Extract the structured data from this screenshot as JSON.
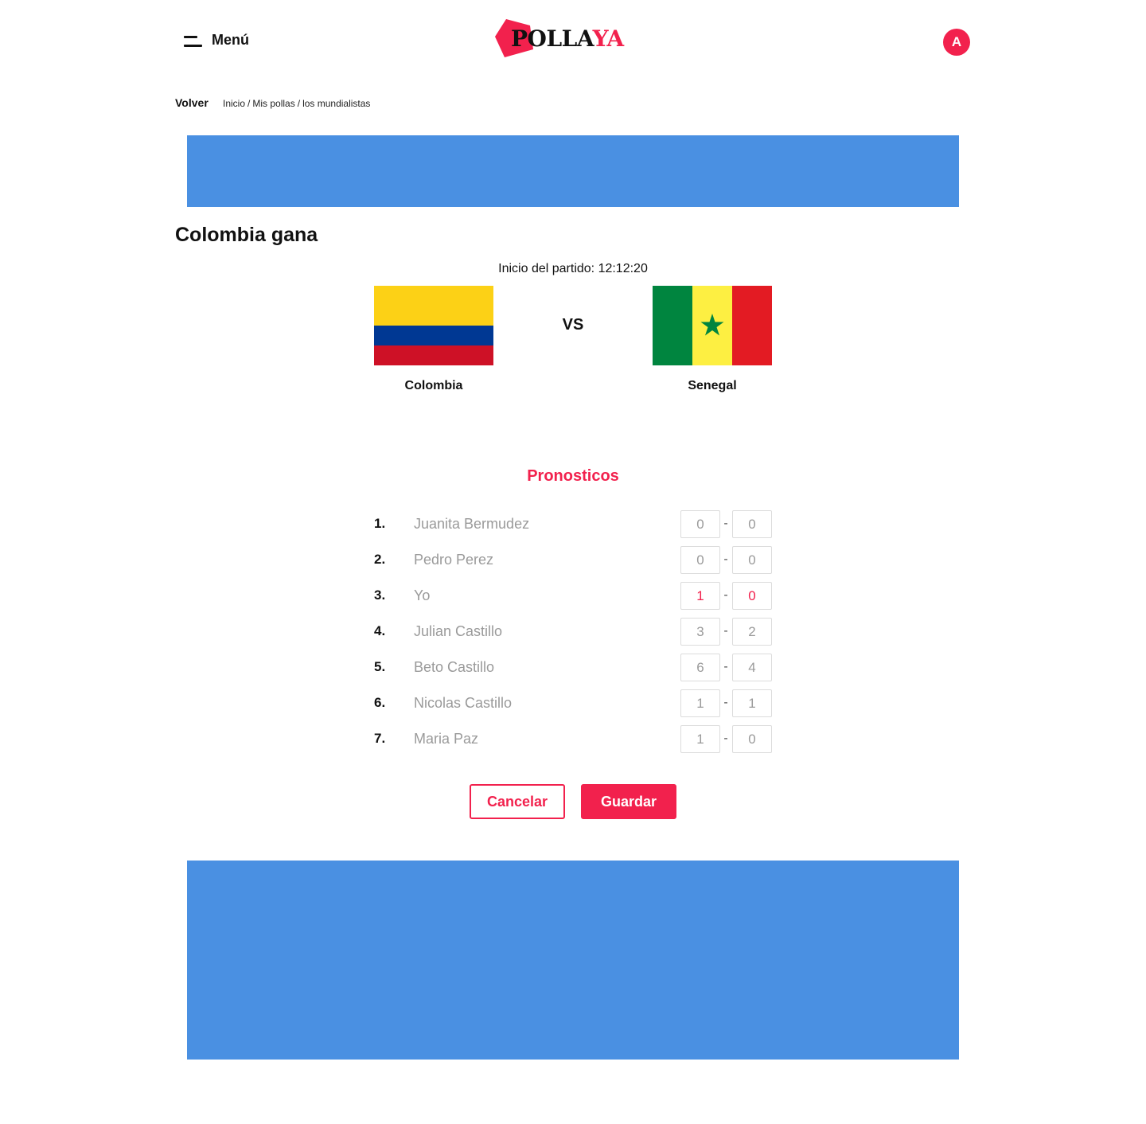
{
  "header": {
    "menu_label": "Menú",
    "logo_part1": "POLLA",
    "logo_part2": "YA",
    "avatar_initial": "A"
  },
  "breadcrumb": {
    "back_label": "Volver",
    "items": [
      "Inicio",
      "Mis pollas",
      "los mundialistas"
    ]
  },
  "match": {
    "title": "Colombia gana",
    "kickoff": "Inicio del partido: 12:12:20",
    "vs_label": "VS",
    "home_team": "Colombia",
    "away_team": "Senegal"
  },
  "predictions": {
    "title": "Pronosticos",
    "rows": [
      {
        "rank": "1.",
        "name": "Juanita Bermudez",
        "home": "0",
        "away": "0"
      },
      {
        "rank": "2.",
        "name": "Pedro Perez",
        "home": "0",
        "away": "0"
      },
      {
        "rank": "3.",
        "name": "Yo",
        "home": "1",
        "away": "0"
      },
      {
        "rank": "4.",
        "name": "Julian Castillo",
        "home": "3",
        "away": "2"
      },
      {
        "rank": "5.",
        "name": "Beto Castillo",
        "home": "6",
        "away": "4"
      },
      {
        "rank": "6.",
        "name": "Nicolas Castillo",
        "home": "1",
        "away": "1"
      },
      {
        "rank": "7.",
        "name": "Maria Paz",
        "home": "1",
        "away": "0"
      }
    ],
    "separator": "-"
  },
  "actions": {
    "cancel_label": "Cancelar",
    "save_label": "Guardar"
  },
  "colors": {
    "accent": "#f2214d",
    "banner": "#4a90e2"
  }
}
